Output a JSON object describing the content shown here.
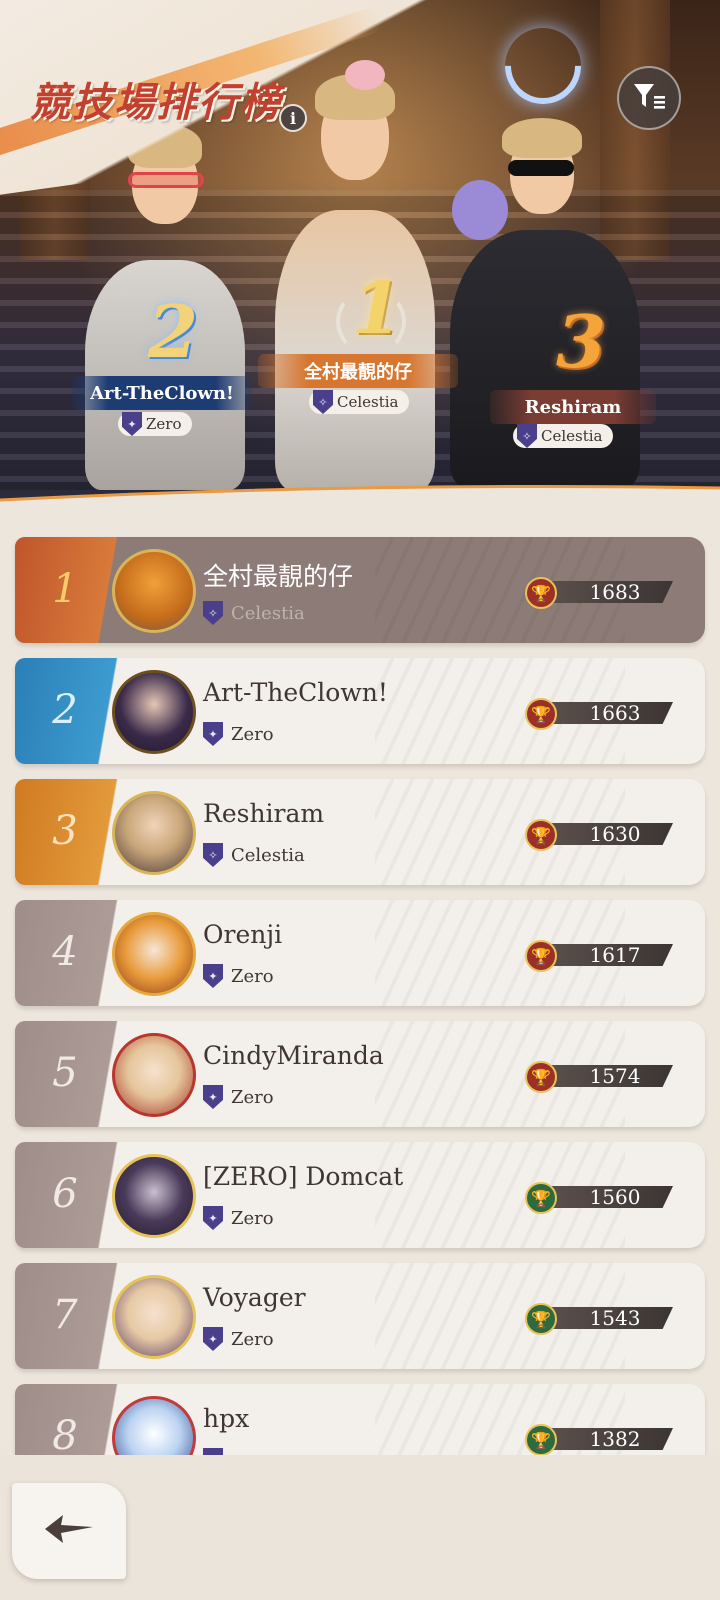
{
  "header": {
    "title": "競技場排行榜",
    "info_label": "i",
    "filter_icon": "filter-list-icon"
  },
  "podium": [
    {
      "rank": "1",
      "name": "全村最靚的仔",
      "guild": "Celestia"
    },
    {
      "rank": "2",
      "name": "Art-TheClown!",
      "guild": "Zero"
    },
    {
      "rank": "3",
      "name": "Reshiram",
      "guild": "Celestia"
    }
  ],
  "leaderboard": [
    {
      "rank": "1",
      "name": "全村最靚的仔",
      "guild": "Celestia",
      "score": "1683",
      "trophy": "red"
    },
    {
      "rank": "2",
      "name": "Art-TheClown!",
      "guild": "Zero",
      "score": "1663",
      "trophy": "red"
    },
    {
      "rank": "3",
      "name": "Reshiram",
      "guild": "Celestia",
      "score": "1630",
      "trophy": "red"
    },
    {
      "rank": "4",
      "name": "Orenji",
      "guild": "Zero",
      "score": "1617",
      "trophy": "red"
    },
    {
      "rank": "5",
      "name": "CindyMiranda",
      "guild": "Zero",
      "score": "1574",
      "trophy": "red"
    },
    {
      "rank": "6",
      "name": "[ZERO] Domcat",
      "guild": "Zero",
      "score": "1560",
      "trophy": "green"
    },
    {
      "rank": "7",
      "name": "Voyager",
      "guild": "Zero",
      "score": "1543",
      "trophy": "green"
    },
    {
      "rank": "8",
      "name": "hpx",
      "guild": "",
      "score": "1382",
      "trophy": "green"
    }
  ],
  "colors": {
    "rank1_tab": "#c65a2a",
    "rank2_tab": "#2f8cc0",
    "rank3_tab": "#d98a2a",
    "rank_other_tab": "#a4928e",
    "trophy_red": "#9c2f26",
    "trophy_green": "#2f6a3e"
  },
  "footer": {
    "back_icon": "back-arrow-icon"
  }
}
